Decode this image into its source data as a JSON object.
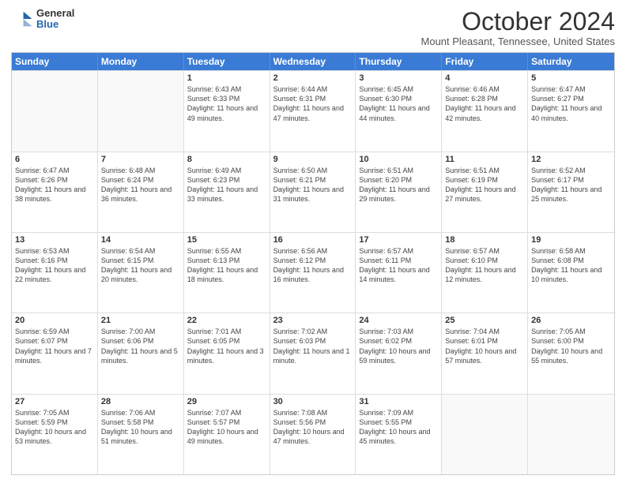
{
  "header": {
    "logo_general": "General",
    "logo_blue": "Blue",
    "month_title": "October 2024",
    "location": "Mount Pleasant, Tennessee, United States"
  },
  "days_of_week": [
    "Sunday",
    "Monday",
    "Tuesday",
    "Wednesday",
    "Thursday",
    "Friday",
    "Saturday"
  ],
  "weeks": [
    [
      {
        "day": "",
        "empty": true
      },
      {
        "day": "",
        "empty": true
      },
      {
        "day": "1",
        "sunrise": "6:43 AM",
        "sunset": "6:33 PM",
        "daylight": "11 hours and 49 minutes."
      },
      {
        "day": "2",
        "sunrise": "6:44 AM",
        "sunset": "6:31 PM",
        "daylight": "11 hours and 47 minutes."
      },
      {
        "day": "3",
        "sunrise": "6:45 AM",
        "sunset": "6:30 PM",
        "daylight": "11 hours and 44 minutes."
      },
      {
        "day": "4",
        "sunrise": "6:46 AM",
        "sunset": "6:28 PM",
        "daylight": "11 hours and 42 minutes."
      },
      {
        "day": "5",
        "sunrise": "6:47 AM",
        "sunset": "6:27 PM",
        "daylight": "11 hours and 40 minutes."
      }
    ],
    [
      {
        "day": "6",
        "sunrise": "6:47 AM",
        "sunset": "6:26 PM",
        "daylight": "11 hours and 38 minutes."
      },
      {
        "day": "7",
        "sunrise": "6:48 AM",
        "sunset": "6:24 PM",
        "daylight": "11 hours and 36 minutes."
      },
      {
        "day": "8",
        "sunrise": "6:49 AM",
        "sunset": "6:23 PM",
        "daylight": "11 hours and 33 minutes."
      },
      {
        "day": "9",
        "sunrise": "6:50 AM",
        "sunset": "6:21 PM",
        "daylight": "11 hours and 31 minutes."
      },
      {
        "day": "10",
        "sunrise": "6:51 AM",
        "sunset": "6:20 PM",
        "daylight": "11 hours and 29 minutes."
      },
      {
        "day": "11",
        "sunrise": "6:51 AM",
        "sunset": "6:19 PM",
        "daylight": "11 hours and 27 minutes."
      },
      {
        "day": "12",
        "sunrise": "6:52 AM",
        "sunset": "6:17 PM",
        "daylight": "11 hours and 25 minutes."
      }
    ],
    [
      {
        "day": "13",
        "sunrise": "6:53 AM",
        "sunset": "6:16 PM",
        "daylight": "11 hours and 22 minutes."
      },
      {
        "day": "14",
        "sunrise": "6:54 AM",
        "sunset": "6:15 PM",
        "daylight": "11 hours and 20 minutes."
      },
      {
        "day": "15",
        "sunrise": "6:55 AM",
        "sunset": "6:13 PM",
        "daylight": "11 hours and 18 minutes."
      },
      {
        "day": "16",
        "sunrise": "6:56 AM",
        "sunset": "6:12 PM",
        "daylight": "11 hours and 16 minutes."
      },
      {
        "day": "17",
        "sunrise": "6:57 AM",
        "sunset": "6:11 PM",
        "daylight": "11 hours and 14 minutes."
      },
      {
        "day": "18",
        "sunrise": "6:57 AM",
        "sunset": "6:10 PM",
        "daylight": "11 hours and 12 minutes."
      },
      {
        "day": "19",
        "sunrise": "6:58 AM",
        "sunset": "6:08 PM",
        "daylight": "11 hours and 10 minutes."
      }
    ],
    [
      {
        "day": "20",
        "sunrise": "6:59 AM",
        "sunset": "6:07 PM",
        "daylight": "11 hours and 7 minutes."
      },
      {
        "day": "21",
        "sunrise": "7:00 AM",
        "sunset": "6:06 PM",
        "daylight": "11 hours and 5 minutes."
      },
      {
        "day": "22",
        "sunrise": "7:01 AM",
        "sunset": "6:05 PM",
        "daylight": "11 hours and 3 minutes."
      },
      {
        "day": "23",
        "sunrise": "7:02 AM",
        "sunset": "6:03 PM",
        "daylight": "11 hours and 1 minute."
      },
      {
        "day": "24",
        "sunrise": "7:03 AM",
        "sunset": "6:02 PM",
        "daylight": "10 hours and 59 minutes."
      },
      {
        "day": "25",
        "sunrise": "7:04 AM",
        "sunset": "6:01 PM",
        "daylight": "10 hours and 57 minutes."
      },
      {
        "day": "26",
        "sunrise": "7:05 AM",
        "sunset": "6:00 PM",
        "daylight": "10 hours and 55 minutes."
      }
    ],
    [
      {
        "day": "27",
        "sunrise": "7:05 AM",
        "sunset": "5:59 PM",
        "daylight": "10 hours and 53 minutes."
      },
      {
        "day": "28",
        "sunrise": "7:06 AM",
        "sunset": "5:58 PM",
        "daylight": "10 hours and 51 minutes."
      },
      {
        "day": "29",
        "sunrise": "7:07 AM",
        "sunset": "5:57 PM",
        "daylight": "10 hours and 49 minutes."
      },
      {
        "day": "30",
        "sunrise": "7:08 AM",
        "sunset": "5:56 PM",
        "daylight": "10 hours and 47 minutes."
      },
      {
        "day": "31",
        "sunrise": "7:09 AM",
        "sunset": "5:55 PM",
        "daylight": "10 hours and 45 minutes."
      },
      {
        "day": "",
        "empty": true
      },
      {
        "day": "",
        "empty": true
      }
    ]
  ]
}
